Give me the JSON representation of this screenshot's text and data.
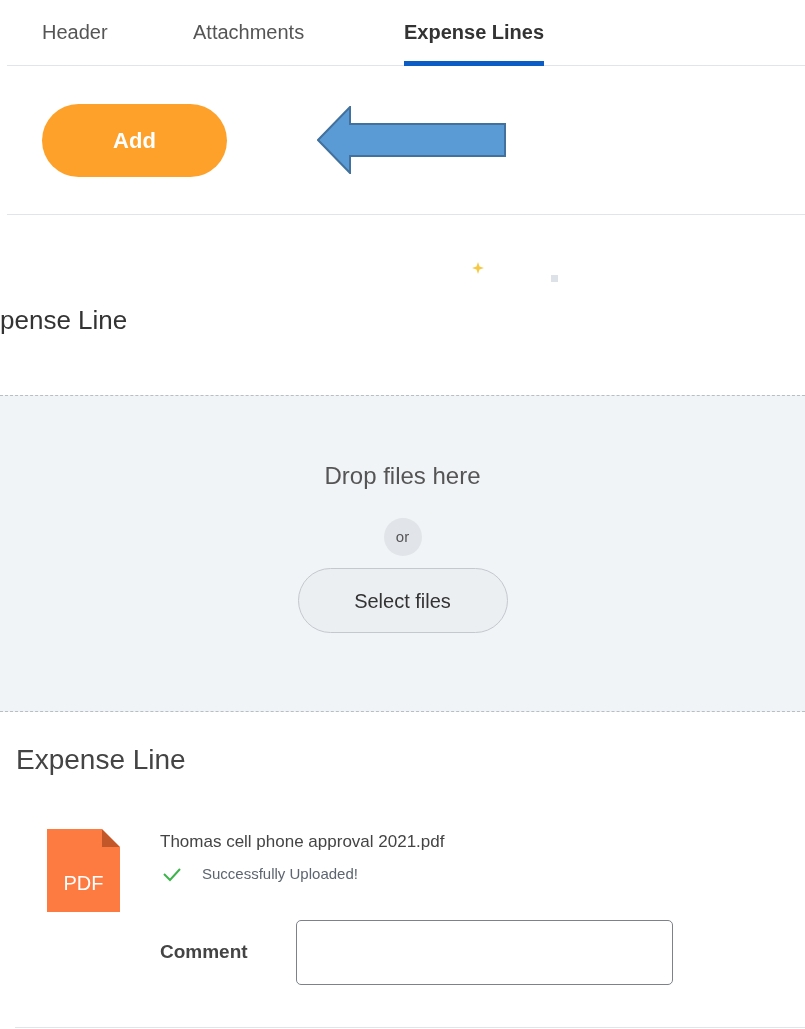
{
  "tabs": [
    {
      "label": "Header",
      "selected": false
    },
    {
      "label": "Attachments",
      "selected": false
    },
    {
      "label": "Expense Lines",
      "selected": true
    }
  ],
  "toolbar": {
    "add_button": "Add"
  },
  "cut_section_title": "pense Line",
  "dropzone": {
    "prompt": "Drop files here",
    "separator": "or",
    "button": "Select files"
  },
  "section_title": "Expense Line",
  "file": {
    "type_label": "PDF",
    "name": "Thomas cell phone approval 2021.pdf",
    "status": "Successfully Uploaded!",
    "uploaded": true
  },
  "comment": {
    "label": "Comment"
  }
}
